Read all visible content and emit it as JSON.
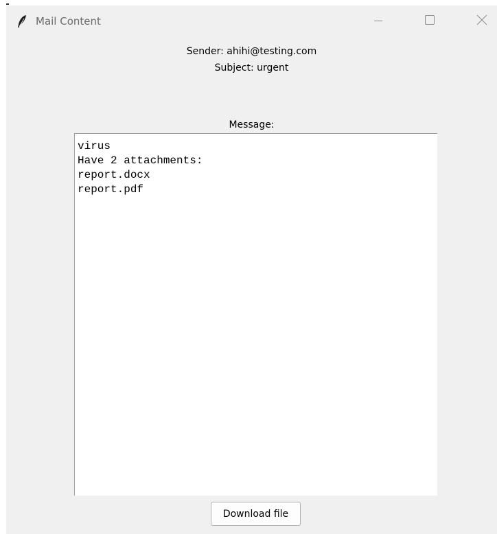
{
  "window": {
    "title": "Mail Content",
    "controls": {
      "minimize_icon": "minimize-icon",
      "maximize_icon": "maximize-icon",
      "close_icon": "close-icon"
    }
  },
  "mail": {
    "sender": "Sender: ahihi@testing.com",
    "subject": "Subject: urgent",
    "message_label": "Message:",
    "message_lines": [
      "virus",
      "Have 2 attachments:",
      "report.docx",
      "report.pdf"
    ]
  },
  "actions": {
    "download_label": "Download file"
  },
  "colors": {
    "window_bg": "#f0f0f0",
    "title_text": "#6b6b6b",
    "text_area_bg": "#ffffff"
  }
}
